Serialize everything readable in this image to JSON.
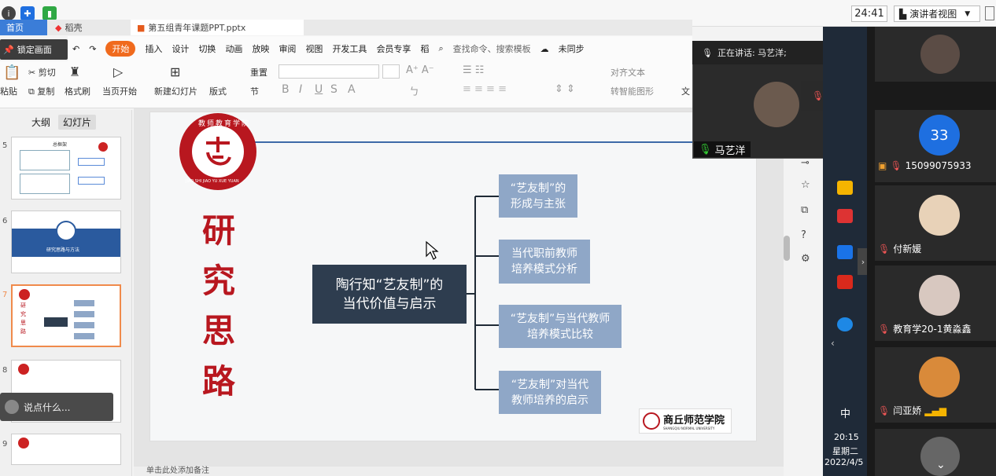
{
  "topbar": {
    "timer": "24:41",
    "view_label": "演讲者视图",
    "view_arrow": "▼"
  },
  "wps": {
    "tab_home": "首页",
    "tab_daoke": "稻壳",
    "tab_file": "第五组青年课题PPT.pptx",
    "lock_label": "锁定画面",
    "menus": [
      "开始",
      "插入",
      "设计",
      "切换",
      "动画",
      "放映",
      "审阅",
      "视图",
      "开发工具",
      "会员专享",
      "稻"
    ],
    "search_placeholder": "查找命令、搜索模板",
    "sync_label": "未同步",
    "paste": "粘贴",
    "cut": "剪切",
    "copy": "复制",
    "format_painter": "格式刷",
    "play_from_current": "当页开始",
    "new_slide": "新建幻灯片",
    "layout": "版式",
    "section": "节",
    "reset": "重置",
    "align_text": "对齐文本",
    "smart_art": "转智能图形",
    "text_label": "文"
  },
  "thumbs": {
    "tab_outline": "大纲",
    "tab_slides": "幻灯片",
    "slide5_title": "总框架",
    "slide6_title": "研究思路与方法",
    "slide7_title": "研究思路",
    "nums": [
      "5",
      "6",
      "7",
      "8",
      "9"
    ]
  },
  "slide": {
    "vertical_title": [
      "研",
      "究",
      "思",
      "路"
    ],
    "logo_ring_top": "教师教育学院",
    "logo_ring_bottom": "JIAO SHI JIAO YU XUE YUAN",
    "central": [
      "陶行知“艺友制”的",
      "当代价值与启示"
    ],
    "branches": [
      [
        "“艺友制”的",
        "形成与主张"
      ],
      [
        "当代职前教师",
        "培养模式分析"
      ],
      [
        "“艺友制”与当代教师",
        "培养模式比较"
      ],
      [
        "“艺友制”对当代",
        "教师培养的启示"
      ]
    ],
    "univ_cn": "商丘师范学院",
    "univ_en": "SHANGQIU NORMAL UNIVERSITY"
  },
  "meeting": {
    "speaking_now": "正在讲话: 马艺洋;",
    "main_speaker": "马艺洋",
    "participants": [
      {
        "name": "15099075933",
        "badge": "33"
      },
      {
        "name": "付新媛"
      },
      {
        "name": "教育学20-1黄淼鑫"
      },
      {
        "name": "闫亚娇"
      }
    ]
  },
  "taskbar": {
    "time": "20:15",
    "weekday": "星期二",
    "date": "2022/4/5",
    "ime": "中"
  },
  "left_comment": "说点什么...",
  "notes_placeholder": "单击此处添加备注"
}
